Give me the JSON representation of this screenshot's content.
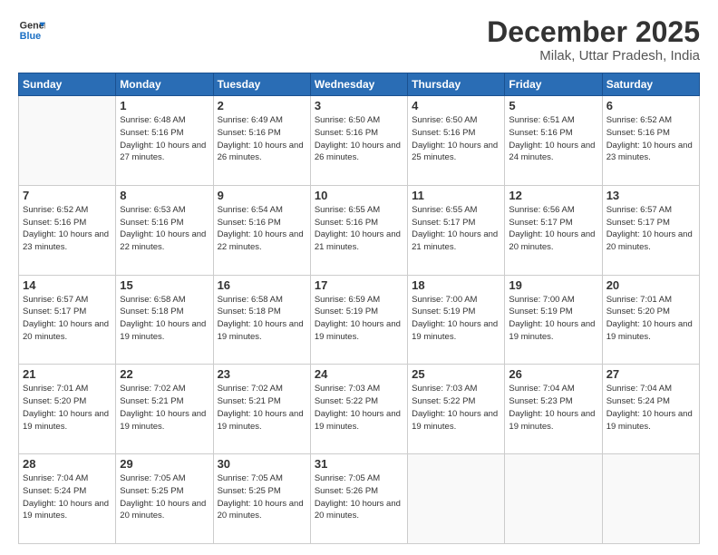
{
  "header": {
    "logo_line1": "General",
    "logo_line2": "Blue",
    "title": "December 2025",
    "subtitle": "Milak, Uttar Pradesh, India"
  },
  "weekdays": [
    "Sunday",
    "Monday",
    "Tuesday",
    "Wednesday",
    "Thursday",
    "Friday",
    "Saturday"
  ],
  "weeks": [
    [
      {
        "day": "",
        "empty": true
      },
      {
        "day": "1",
        "sunrise": "6:48 AM",
        "sunset": "5:16 PM",
        "daylight": "10 hours and 27 minutes."
      },
      {
        "day": "2",
        "sunrise": "6:49 AM",
        "sunset": "5:16 PM",
        "daylight": "10 hours and 26 minutes."
      },
      {
        "day": "3",
        "sunrise": "6:50 AM",
        "sunset": "5:16 PM",
        "daylight": "10 hours and 26 minutes."
      },
      {
        "day": "4",
        "sunrise": "6:50 AM",
        "sunset": "5:16 PM",
        "daylight": "10 hours and 25 minutes."
      },
      {
        "day": "5",
        "sunrise": "6:51 AM",
        "sunset": "5:16 PM",
        "daylight": "10 hours and 24 minutes."
      },
      {
        "day": "6",
        "sunrise": "6:52 AM",
        "sunset": "5:16 PM",
        "daylight": "10 hours and 23 minutes."
      }
    ],
    [
      {
        "day": "7",
        "sunrise": "6:52 AM",
        "sunset": "5:16 PM",
        "daylight": "10 hours and 23 minutes."
      },
      {
        "day": "8",
        "sunrise": "6:53 AM",
        "sunset": "5:16 PM",
        "daylight": "10 hours and 22 minutes."
      },
      {
        "day": "9",
        "sunrise": "6:54 AM",
        "sunset": "5:16 PM",
        "daylight": "10 hours and 22 minutes."
      },
      {
        "day": "10",
        "sunrise": "6:55 AM",
        "sunset": "5:16 PM",
        "daylight": "10 hours and 21 minutes."
      },
      {
        "day": "11",
        "sunrise": "6:55 AM",
        "sunset": "5:17 PM",
        "daylight": "10 hours and 21 minutes."
      },
      {
        "day": "12",
        "sunrise": "6:56 AM",
        "sunset": "5:17 PM",
        "daylight": "10 hours and 20 minutes."
      },
      {
        "day": "13",
        "sunrise": "6:57 AM",
        "sunset": "5:17 PM",
        "daylight": "10 hours and 20 minutes."
      }
    ],
    [
      {
        "day": "14",
        "sunrise": "6:57 AM",
        "sunset": "5:17 PM",
        "daylight": "10 hours and 20 minutes."
      },
      {
        "day": "15",
        "sunrise": "6:58 AM",
        "sunset": "5:18 PM",
        "daylight": "10 hours and 19 minutes."
      },
      {
        "day": "16",
        "sunrise": "6:58 AM",
        "sunset": "5:18 PM",
        "daylight": "10 hours and 19 minutes."
      },
      {
        "day": "17",
        "sunrise": "6:59 AM",
        "sunset": "5:19 PM",
        "daylight": "10 hours and 19 minutes."
      },
      {
        "day": "18",
        "sunrise": "7:00 AM",
        "sunset": "5:19 PM",
        "daylight": "10 hours and 19 minutes."
      },
      {
        "day": "19",
        "sunrise": "7:00 AM",
        "sunset": "5:19 PM",
        "daylight": "10 hours and 19 minutes."
      },
      {
        "day": "20",
        "sunrise": "7:01 AM",
        "sunset": "5:20 PM",
        "daylight": "10 hours and 19 minutes."
      }
    ],
    [
      {
        "day": "21",
        "sunrise": "7:01 AM",
        "sunset": "5:20 PM",
        "daylight": "10 hours and 19 minutes."
      },
      {
        "day": "22",
        "sunrise": "7:02 AM",
        "sunset": "5:21 PM",
        "daylight": "10 hours and 19 minutes."
      },
      {
        "day": "23",
        "sunrise": "7:02 AM",
        "sunset": "5:21 PM",
        "daylight": "10 hours and 19 minutes."
      },
      {
        "day": "24",
        "sunrise": "7:03 AM",
        "sunset": "5:22 PM",
        "daylight": "10 hours and 19 minutes."
      },
      {
        "day": "25",
        "sunrise": "7:03 AM",
        "sunset": "5:22 PM",
        "daylight": "10 hours and 19 minutes."
      },
      {
        "day": "26",
        "sunrise": "7:04 AM",
        "sunset": "5:23 PM",
        "daylight": "10 hours and 19 minutes."
      },
      {
        "day": "27",
        "sunrise": "7:04 AM",
        "sunset": "5:24 PM",
        "daylight": "10 hours and 19 minutes."
      }
    ],
    [
      {
        "day": "28",
        "sunrise": "7:04 AM",
        "sunset": "5:24 PM",
        "daylight": "10 hours and 19 minutes."
      },
      {
        "day": "29",
        "sunrise": "7:05 AM",
        "sunset": "5:25 PM",
        "daylight": "10 hours and 20 minutes."
      },
      {
        "day": "30",
        "sunrise": "7:05 AM",
        "sunset": "5:25 PM",
        "daylight": "10 hours and 20 minutes."
      },
      {
        "day": "31",
        "sunrise": "7:05 AM",
        "sunset": "5:26 PM",
        "daylight": "10 hours and 20 minutes."
      },
      {
        "day": "",
        "empty": true
      },
      {
        "day": "",
        "empty": true
      },
      {
        "day": "",
        "empty": true
      }
    ]
  ]
}
